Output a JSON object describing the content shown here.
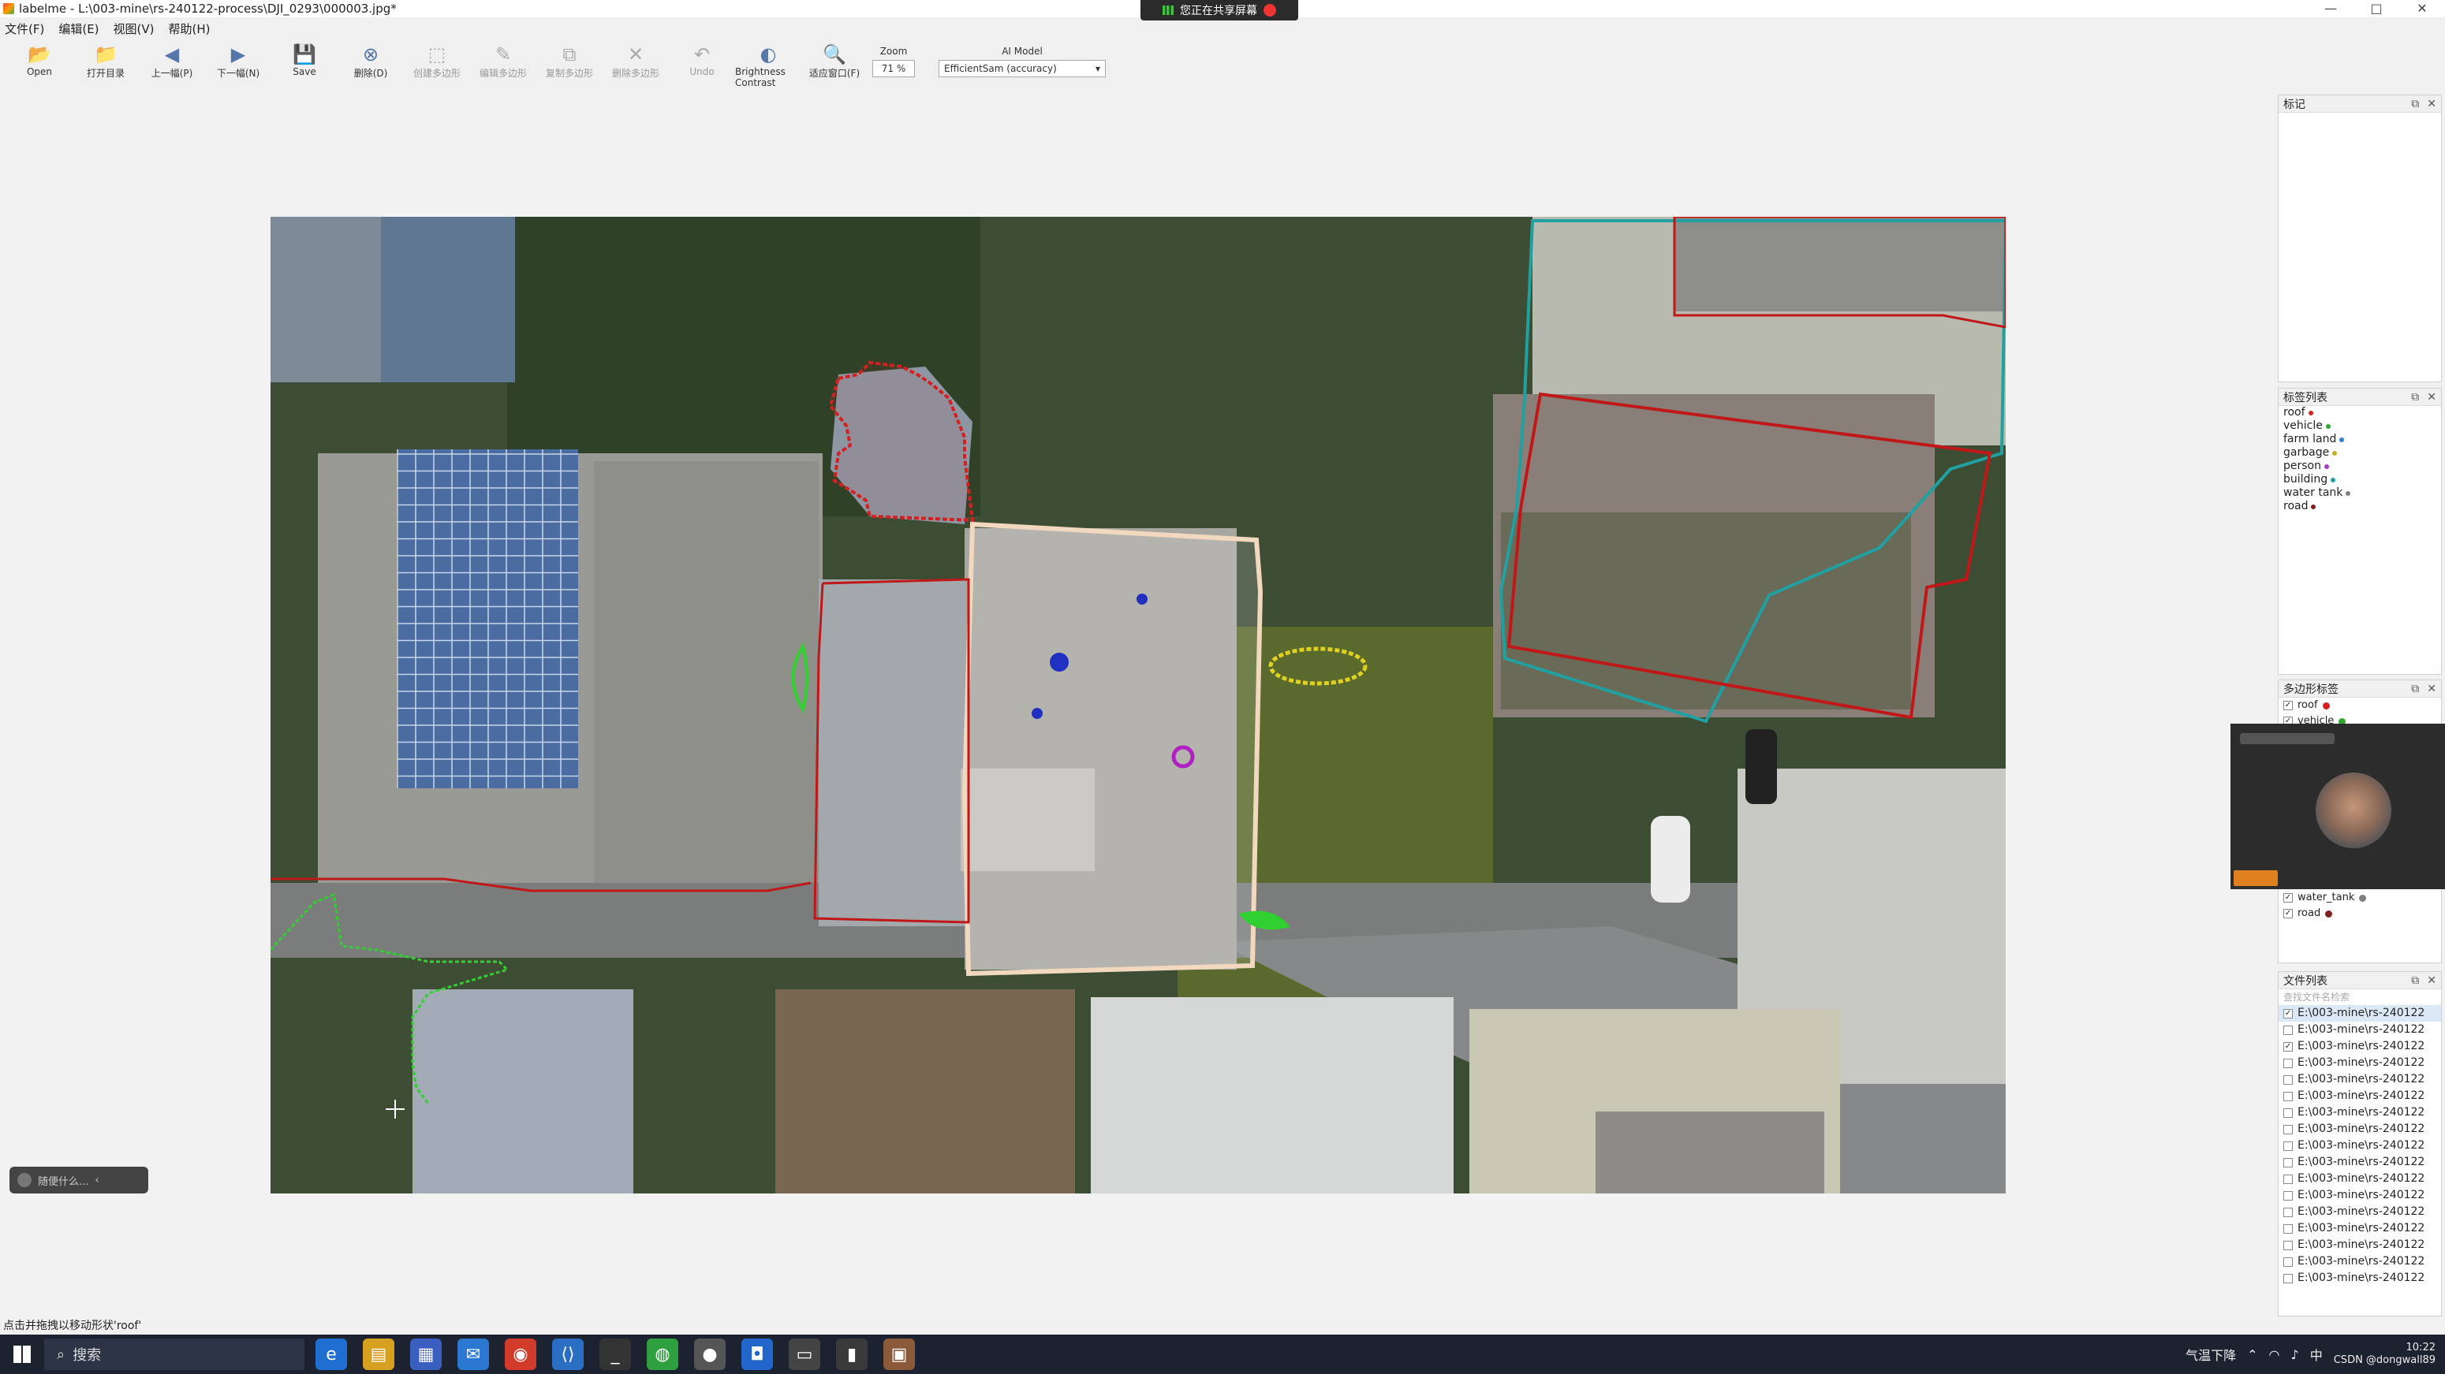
{
  "window": {
    "title": "labelme - L:\\003-mine\\rs-240122-process\\DJI_0293\\000003.jpg*",
    "share_text": "您正在共享屏幕",
    "controls": [
      "—",
      "□",
      "✕"
    ]
  },
  "menu": [
    "文件(F)",
    "编辑(E)",
    "视图(V)",
    "帮助(H)"
  ],
  "toolbar": {
    "tools": [
      {
        "label": "Open",
        "icon": "open-icon",
        "glyph": "📂",
        "enabled": true
      },
      {
        "label": "打开目录",
        "icon": "folder-icon",
        "glyph": "📁",
        "enabled": true
      },
      {
        "label": "上一幅(P)",
        "icon": "prev-icon",
        "glyph": "◀",
        "enabled": true
      },
      {
        "label": "下一幅(N)",
        "icon": "next-icon",
        "glyph": "▶",
        "enabled": true
      },
      {
        "label": "Save",
        "icon": "save-icon",
        "glyph": "💾",
        "enabled": true
      },
      {
        "label": "删除(D)",
        "icon": "delete-icon",
        "glyph": "⊗",
        "enabled": true
      },
      {
        "label": "创建多边形",
        "icon": "create-polygon-icon",
        "glyph": "⬚",
        "enabled": false
      },
      {
        "label": "编辑多边形",
        "icon": "edit-polygon-icon",
        "glyph": "✎",
        "enabled": false
      },
      {
        "label": "复制多边形",
        "icon": "copy-polygon-icon",
        "glyph": "⧉",
        "enabled": false
      },
      {
        "label": "删除多边形",
        "icon": "delete-polygon-icon",
        "glyph": "✕",
        "enabled": false
      },
      {
        "label": "Undo",
        "icon": "undo-icon",
        "glyph": "↶",
        "enabled": false
      },
      {
        "label": "Brightness Contrast",
        "icon": "brightness-icon",
        "glyph": "◐",
        "enabled": true
      },
      {
        "label": "适应窗口(F)",
        "icon": "fit-window-icon",
        "glyph": "🔍",
        "enabled": true
      }
    ],
    "zoom_label": "Zoom",
    "zoom_value": "71 %",
    "ai_label": "AI Model",
    "ai_value": "EfficientSam (accuracy)"
  },
  "mini_pill": "随便什么...",
  "docks": {
    "flags": {
      "title": "标记"
    },
    "label_list": {
      "title": "标签列表",
      "items": [
        {
          "name": "roof",
          "color": "#d42020"
        },
        {
          "name": "vehicle",
          "color": "#2fa82f"
        },
        {
          "name": "farm land",
          "color": "#2f7fd4"
        },
        {
          "name": "garbage",
          "color": "#c0b020"
        },
        {
          "name": "person",
          "color": "#a040c0"
        },
        {
          "name": "building",
          "color": "#20a0a0"
        },
        {
          "name": "water tank",
          "color": "#808080"
        },
        {
          "name": "road",
          "color": "#802020"
        }
      ]
    },
    "polygon_labels": {
      "title": "多边形标签",
      "items": [
        {
          "name": "roof",
          "checked": true,
          "color": "#d42020"
        },
        {
          "name": "vehicle",
          "checked": true,
          "color": "#2fa82f"
        }
      ],
      "tail_items": [
        {
          "name": "water_tank",
          "checked": true,
          "color": "#808080"
        },
        {
          "name": "road",
          "checked": true,
          "color": "#802020"
        }
      ]
    },
    "file_list": {
      "title": "文件列表",
      "search_placeholder": "查找文件名检索",
      "files": [
        {
          "path": "E:\\003-mine\\rs-240122",
          "checked": true
        },
        {
          "path": "E:\\003-mine\\rs-240122",
          "checked": false
        },
        {
          "path": "E:\\003-mine\\rs-240122",
          "checked": true
        },
        {
          "path": "E:\\003-mine\\rs-240122",
          "checked": false
        },
        {
          "path": "E:\\003-mine\\rs-240122",
          "checked": false
        },
        {
          "path": "E:\\003-mine\\rs-240122",
          "checked": false
        },
        {
          "path": "E:\\003-mine\\rs-240122",
          "checked": false
        },
        {
          "path": "E:\\003-mine\\rs-240122",
          "checked": false
        },
        {
          "path": "E:\\003-mine\\rs-240122",
          "checked": false
        },
        {
          "path": "E:\\003-mine\\rs-240122",
          "checked": false
        },
        {
          "path": "E:\\003-mine\\rs-240122",
          "checked": false
        },
        {
          "path": "E:\\003-mine\\rs-240122",
          "checked": false
        },
        {
          "path": "E:\\003-mine\\rs-240122",
          "checked": false
        },
        {
          "path": "E:\\003-mine\\rs-240122",
          "checked": false
        },
        {
          "path": "E:\\003-mine\\rs-240122",
          "checked": false
        },
        {
          "path": "E:\\003-mine\\rs-240122",
          "checked": false
        },
        {
          "path": "E:\\003-mine\\rs-240122",
          "checked": false
        }
      ]
    }
  },
  "status": "点击并拖拽以移动形状'roof'",
  "taskbar": {
    "search_label": "搜索",
    "weather": "气温下降",
    "ime": "中",
    "time": "10:22",
    "date": "CSDN @dongwall89"
  }
}
